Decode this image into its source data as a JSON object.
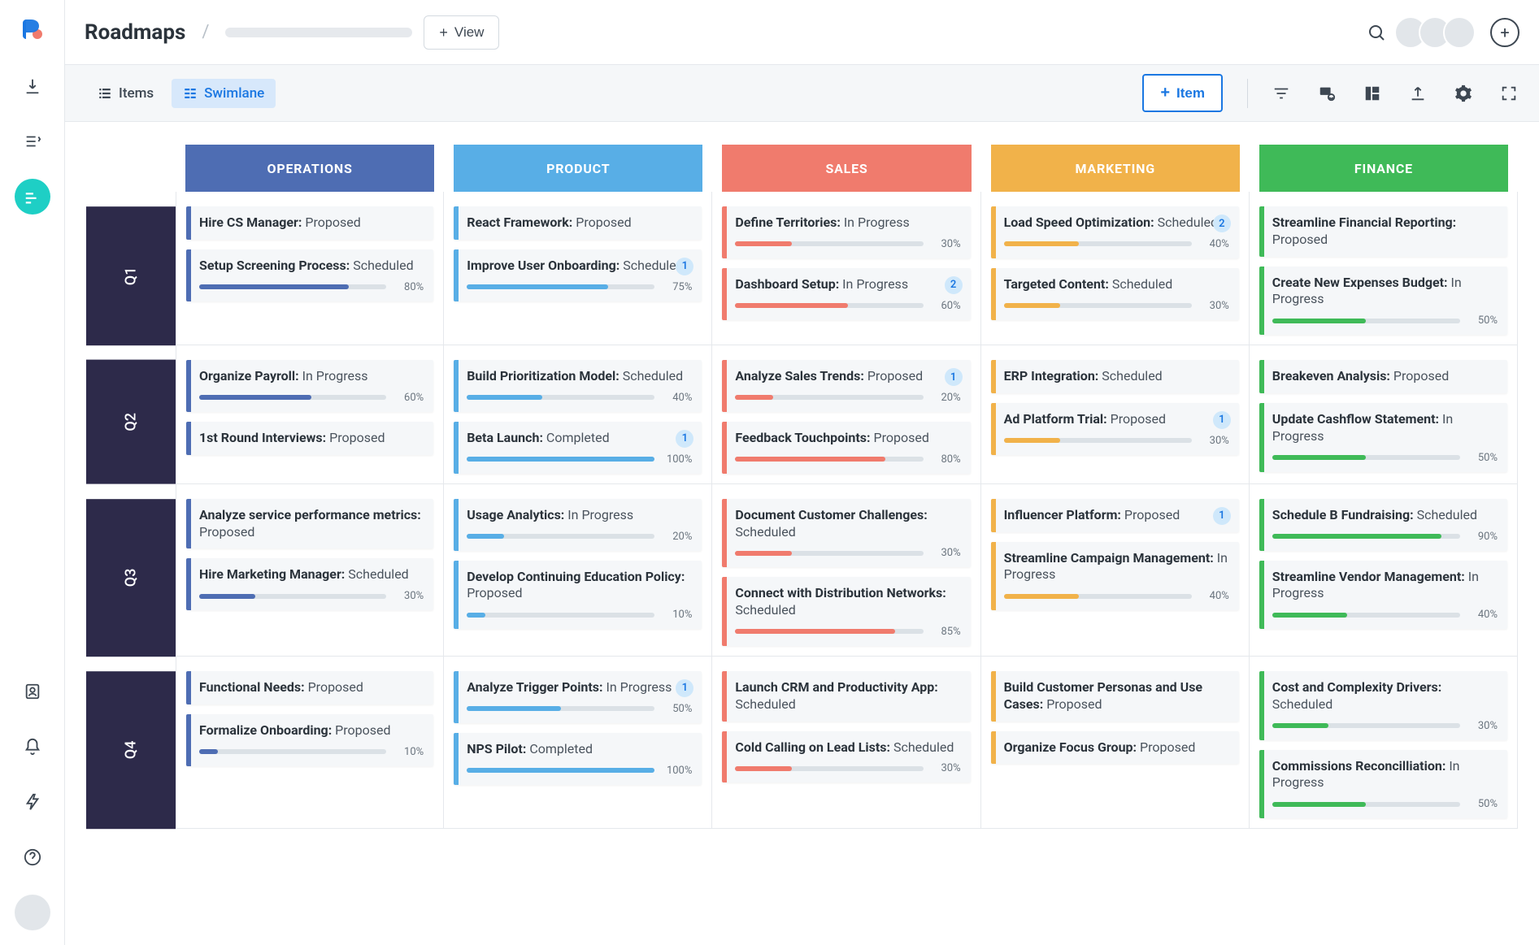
{
  "page_title": "Roadmaps",
  "view_button_label": "View",
  "tabs": {
    "items": "Items",
    "swimlane": "Swimlane"
  },
  "add_item_label": "Item",
  "columns": [
    {
      "key": "operations",
      "label": "OPERATIONS"
    },
    {
      "key": "product",
      "label": "PRODUCT"
    },
    {
      "key": "sales",
      "label": "SALES"
    },
    {
      "key": "marketing",
      "label": "MARKETING"
    },
    {
      "key": "finance",
      "label": "FINANCE"
    }
  ],
  "quarters": [
    "Q1",
    "Q2",
    "Q3",
    "Q4"
  ],
  "board": {
    "Q1": {
      "operations": [
        {
          "title": "Hire CS Manager:",
          "status": "Proposed"
        },
        {
          "title": "Setup Screening Process:",
          "status": "Scheduled",
          "progress": 80
        }
      ],
      "product": [
        {
          "title": "React Framework:",
          "status": "Proposed"
        },
        {
          "title": "Improve User Onboarding:",
          "status": "Scheduled",
          "progress": 75,
          "badge": 1
        }
      ],
      "sales": [
        {
          "title": "Define Territories:",
          "status": "In Progress",
          "progress": 30
        },
        {
          "title": "Dashboard Setup:",
          "status": "In Progress",
          "progress": 60,
          "badge": 2
        }
      ],
      "marketing": [
        {
          "title": "Load Speed Optimization:",
          "status": "Scheduled",
          "progress": 40,
          "badge": 2
        },
        {
          "title": "Targeted Content:",
          "status": "Scheduled",
          "progress": 30
        }
      ],
      "finance": [
        {
          "title": "Streamline Financial Reporting:",
          "status": "Proposed"
        },
        {
          "title": "Create New Expenses Budget:",
          "status": "In Progress",
          "progress": 50
        }
      ]
    },
    "Q2": {
      "operations": [
        {
          "title": "Organize Payroll:",
          "status": "In Progress",
          "progress": 60
        },
        {
          "title": "1st Round Interviews:",
          "status": "Proposed"
        }
      ],
      "product": [
        {
          "title": "Build Prioritization Model:",
          "status": "Scheduled",
          "progress": 40
        },
        {
          "title": "Beta Launch:",
          "status": "Completed",
          "progress": 100,
          "badge": 1
        }
      ],
      "sales": [
        {
          "title": "Analyze Sales Trends:",
          "status": "Proposed",
          "progress": 20,
          "badge": 1
        },
        {
          "title": "Feedback Touchpoints:",
          "status": "Proposed",
          "progress": 80
        }
      ],
      "marketing": [
        {
          "title": "ERP Integration:",
          "status": "Scheduled"
        },
        {
          "title": "Ad Platform Trial:",
          "status": "Proposed",
          "progress": 30,
          "badge": 1
        }
      ],
      "finance": [
        {
          "title": "Breakeven Analysis:",
          "status": "Proposed"
        },
        {
          "title": "Update Cashflow Statement:",
          "status": "In Progress",
          "progress": 50
        }
      ]
    },
    "Q3": {
      "operations": [
        {
          "title": "Analyze service performance metrics:",
          "status": "Proposed"
        },
        {
          "title": "Hire Marketing Manager:",
          "status": "Scheduled",
          "progress": 30
        }
      ],
      "product": [
        {
          "title": "Usage Analytics:",
          "status": "In Progress",
          "progress": 20
        },
        {
          "title": "Develop Continuing Education Policy:",
          "status": "Proposed",
          "progress": 10
        }
      ],
      "sales": [
        {
          "title": "Document Customer Challenges:",
          "status": "Scheduled",
          "progress": 30
        },
        {
          "title": "Connect with Distribution Networks:",
          "status": "Scheduled",
          "progress": 85
        }
      ],
      "marketing": [
        {
          "title": "Influencer Platform:",
          "status": "Proposed",
          "badge": 1
        },
        {
          "title": "Streamline Campaign Management:",
          "status": "In Progress",
          "progress": 40
        }
      ],
      "finance": [
        {
          "title": "Schedule B Fundraising:",
          "status": "Scheduled",
          "progress": 90
        },
        {
          "title": "Streamline Vendor Management:",
          "status": "In Progress",
          "progress": 40
        }
      ]
    },
    "Q4": {
      "operations": [
        {
          "title": "Functional Needs:",
          "status": "Proposed"
        },
        {
          "title": "Formalize Onboarding:",
          "status": "Proposed",
          "progress": 10
        }
      ],
      "product": [
        {
          "title": "Analyze Trigger Points:",
          "status": "In Progress",
          "progress": 50,
          "badge": 1
        },
        {
          "title": "NPS Pilot:",
          "status": "Completed",
          "progress": 100
        }
      ],
      "sales": [
        {
          "title": "Launch CRM and Productivity App:",
          "status": "Scheduled"
        },
        {
          "title": "Cold Calling on Lead Lists:",
          "status": "Scheduled",
          "progress": 30
        }
      ],
      "marketing": [
        {
          "title": "Build Customer Personas and Use Cases:",
          "status": "Proposed"
        },
        {
          "title": "Organize Focus Group:",
          "status": "Proposed"
        }
      ],
      "finance": [
        {
          "title": "Cost and Complexity Drivers:",
          "status": "Scheduled",
          "progress": 30
        },
        {
          "title": "Commissions Reconcilliation:",
          "status": "In Progress",
          "progress": 50
        }
      ]
    }
  }
}
